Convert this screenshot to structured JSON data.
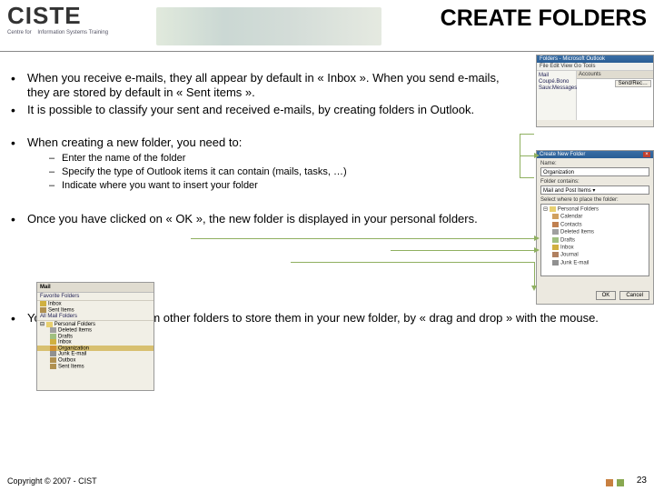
{
  "logo": {
    "main": "CISTE",
    "sub1": "Centre for",
    "sub2": "Information Systems Training"
  },
  "title": "CREATE FOLDERS",
  "bullets": {
    "b1": "When you receive e-mails, they all appear by default in « Inbox ». When you send e-mails, they are stored by default in « Sent items ».",
    "b2": "It is possible to classify your sent and received e-mails, by creating folders in Outlook.",
    "b3": "When creating a new folder, you need to:",
    "b3s1": "Enter the name of the folder",
    "b3s2": "Specify the type of Outlook items it can contain (mails, tasks, …)",
    "b3s3": "Indicate where you want to insert your folder",
    "b4": "Once you have clicked on « OK », the new folder is displayed in your personal folders.",
    "b5": "You can move items from other folders to store them in your new folder, by « drag and drop » with the mouse."
  },
  "thumb1": {
    "title": "Folders - Microsoft Outlook",
    "menu": "File  Edit  View  Go  Tools",
    "left": {
      "i1": "Mail",
      "i2": "Coupé.Bono",
      "i3": "Sauv.Messages"
    },
    "right": {
      "h": "Accounts",
      "btn": "Send/Rec…"
    }
  },
  "thumb2": {
    "title": "Create New Folder",
    "lbl_name": "Name:",
    "val_name": "Organization",
    "lbl_contains": "Folder contains:",
    "val_contains": "Mail and Post Items",
    "lbl_where": "Select where to place the folder:",
    "tree": {
      "pf": "Personal Folders",
      "cal": "Calendar",
      "con": "Contacts",
      "del": "Deleted Items",
      "dra": "Drafts",
      "inb": "Inbox",
      "jou": "Journal",
      "jnk": "Junk E-mail"
    },
    "ok": "OK",
    "cancel": "Cancel"
  },
  "thumb3": {
    "h": "Mail",
    "fav": "Favorite Folders",
    "favi1": "Inbox",
    "favi2": "Sent Items",
    "all": "All Mail Folders",
    "pf": "Personal Folders",
    "items": {
      "del": "Deleted Items",
      "dra": "Drafts",
      "inb": "Inbox",
      "org": "Organization",
      "jnk": "Junk E-mail",
      "out": "Outbox",
      "sen": "Sent Items"
    }
  },
  "footer": "Copyright © 2007 - CIST",
  "page": "23"
}
